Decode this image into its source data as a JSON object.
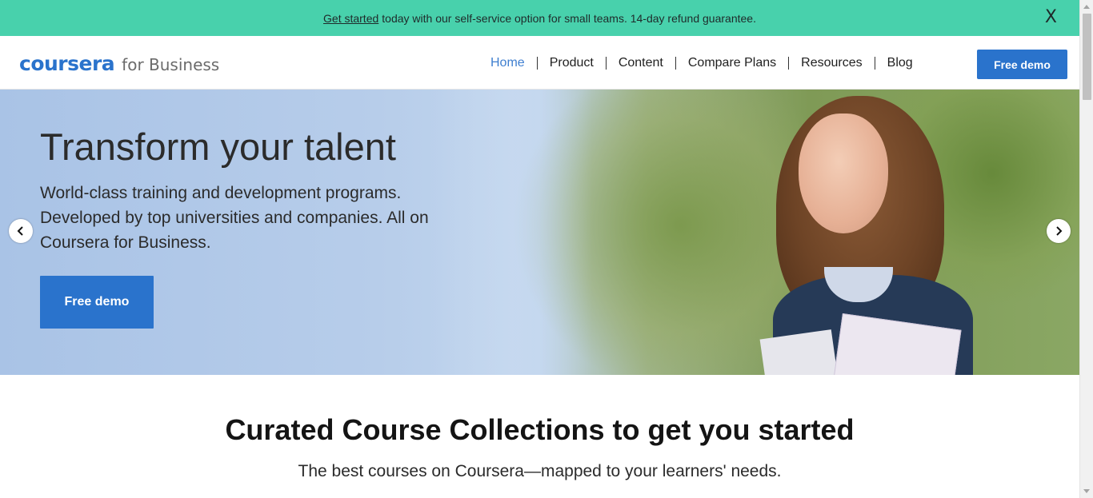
{
  "banner": {
    "link_text": "Get started",
    "text": "today with our self-service option for small teams. 14-day refund guarantee.",
    "close_label": "X"
  },
  "header": {
    "logo_brand": "coursera",
    "logo_sub": "for Business",
    "nav": [
      {
        "label": "Home",
        "active": true
      },
      {
        "label": "Product"
      },
      {
        "label": "Content"
      },
      {
        "label": "Compare Plans"
      },
      {
        "label": "Resources"
      },
      {
        "label": "Blog"
      }
    ],
    "cta_label": "Free demo"
  },
  "hero": {
    "title": "Transform your talent",
    "subtitle": "World-class training and development programs. Developed by top universities and companies. All on Coursera for Business.",
    "cta_label": "Free demo",
    "prev_icon": "chevron-left-icon",
    "next_icon": "chevron-right-icon"
  },
  "section": {
    "title": "Curated Course Collections to get you started",
    "subtitle": "The best courses on Coursera—mapped to your learners' needs."
  },
  "colors": {
    "banner_bg": "#48d1ac",
    "accent": "#2a73cc",
    "nav_active": "#3f7fd0"
  }
}
